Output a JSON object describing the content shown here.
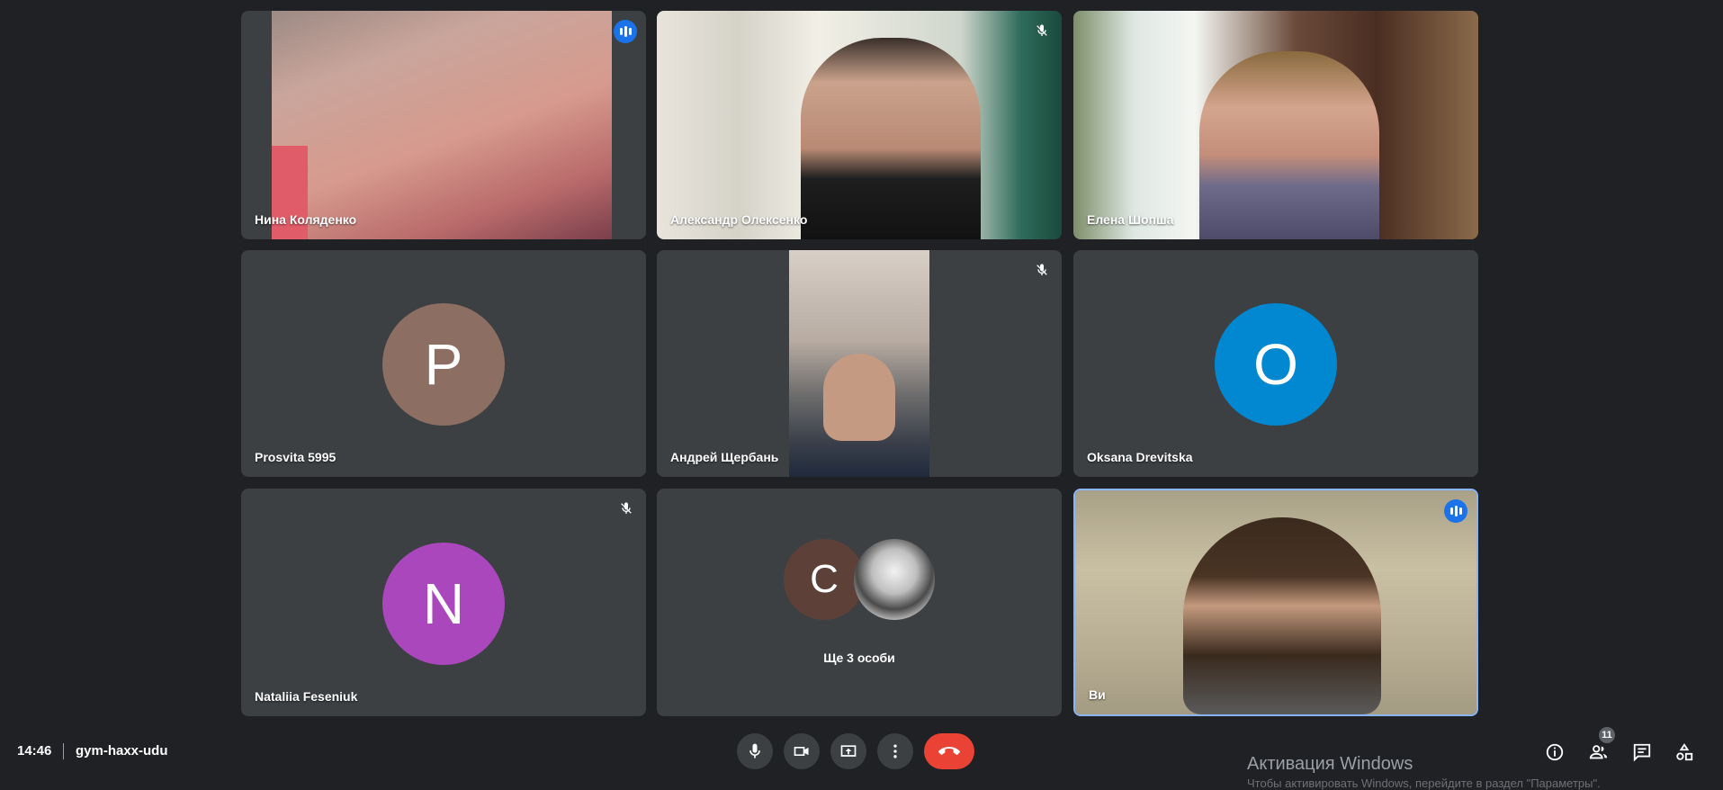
{
  "participants": [
    {
      "name": "Нина Коляденко",
      "state": "speaking"
    },
    {
      "name": "Александр Олексенко",
      "state": "muted"
    },
    {
      "name": "Елена Шопша",
      "state": "none"
    },
    {
      "name": "Prosvita 5995",
      "avatar_letter": "P",
      "avatar_color": "#8d6e63",
      "state": "none"
    },
    {
      "name": "Андрей Щербань",
      "state": "muted"
    },
    {
      "name": "Oksana Drevitska",
      "avatar_letter": "O",
      "avatar_color": "#0288d1",
      "state": "none"
    },
    {
      "name": "Nataliia Feseniuk",
      "avatar_letter": "N",
      "avatar_color": "#ab47bc",
      "state": "muted"
    },
    {
      "others_label": "Ще 3 особи",
      "avatar_letter": "C",
      "avatar_color": "#5d4037"
    },
    {
      "name": "Ви",
      "state": "speaking",
      "active": true
    }
  ],
  "footer": {
    "time": "14:46",
    "meeting_code": "gym-haxx-udu",
    "people_count": "11"
  },
  "controls": [
    "mic-icon",
    "camera-icon",
    "present-screen-icon",
    "more-options-icon",
    "end-call-icon"
  ],
  "right_controls": [
    "info-icon",
    "people-icon",
    "chat-icon",
    "activities-icon"
  ],
  "watermark": {
    "title": "Активация Windows",
    "subtitle": "Чтобы активировать Windows, перейдите в раздел \"Параметры\"."
  },
  "colors": {
    "background": "#202124",
    "tile": "#3c4043",
    "accent": "#1a73e8",
    "end_call": "#ea4335",
    "active_border": "#8ab4f8"
  }
}
